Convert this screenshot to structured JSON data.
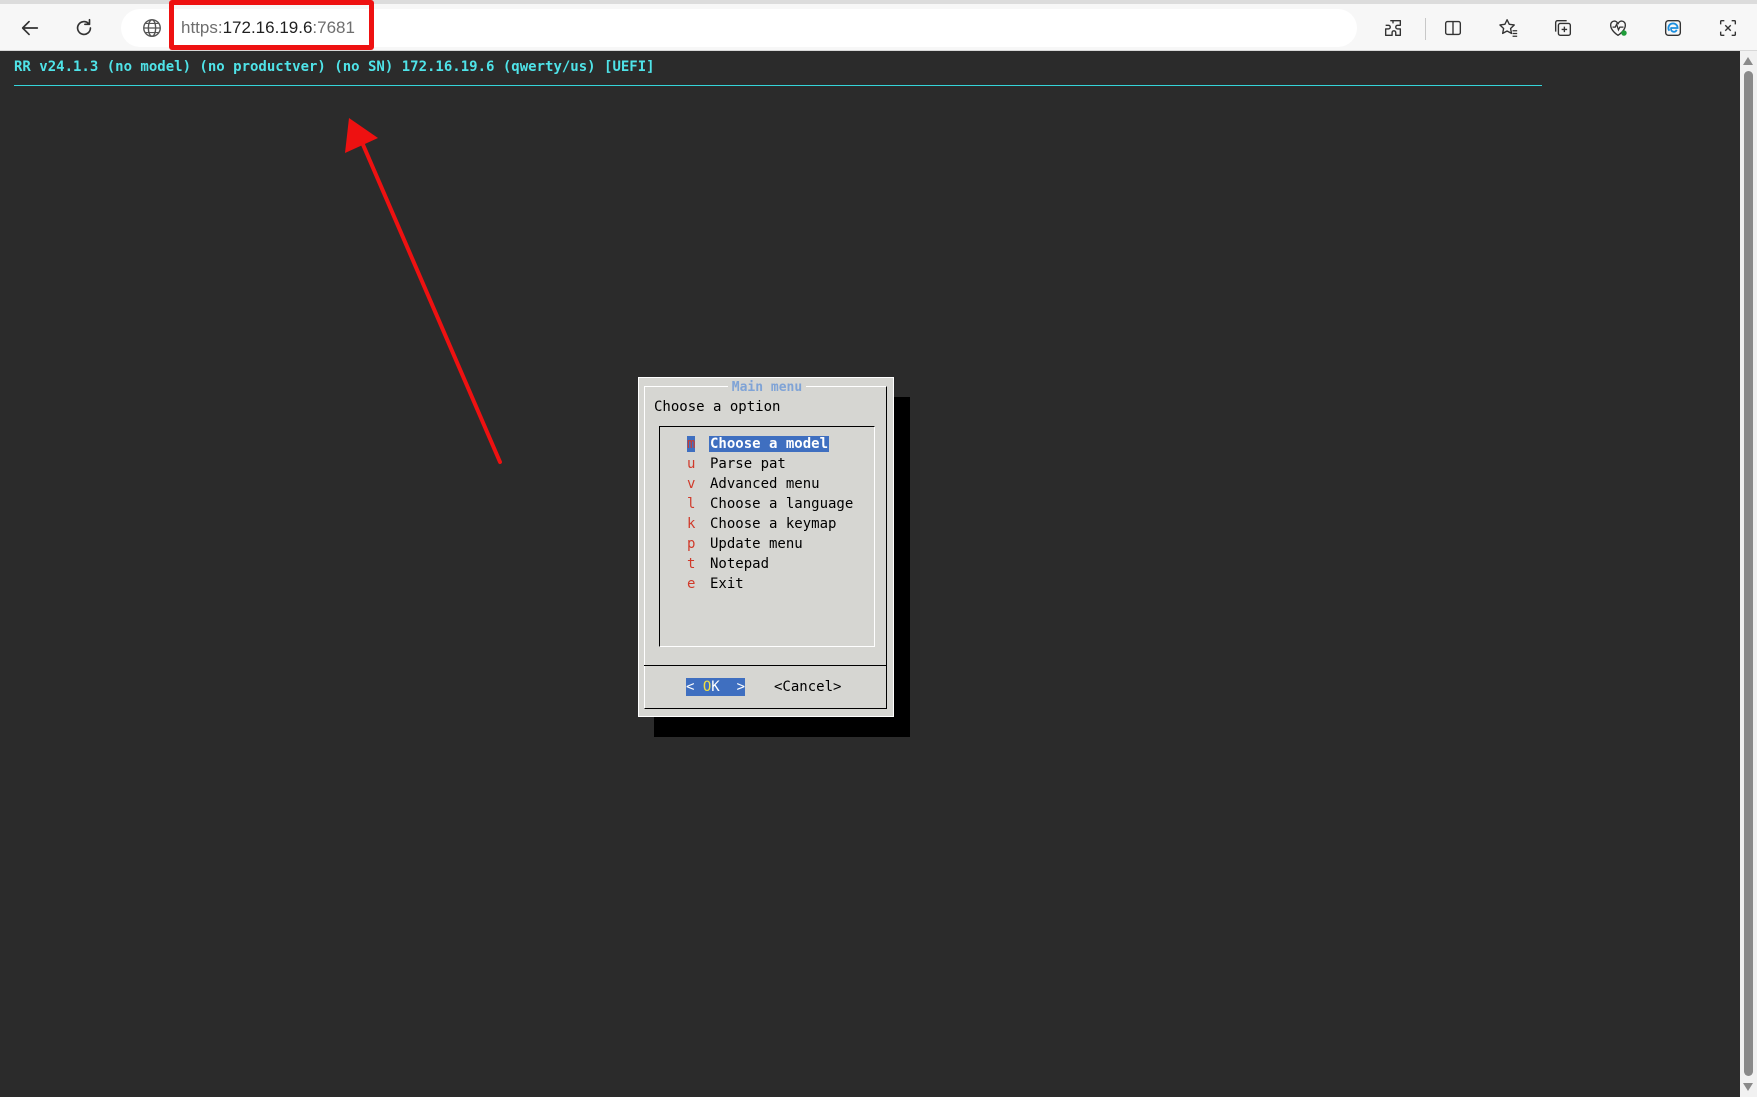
{
  "browser": {
    "url_scheme": "https:",
    "url_host": "172.16.19.6",
    "url_port": ":7681",
    "icons": [
      "back-arrow-icon",
      "reload-icon",
      "globe-icon",
      "extensions-icon",
      "split-screen-icon",
      "favorites-icon",
      "collections-icon",
      "browser-essentials-icon",
      "edge-copilot-icon",
      "screenshot-icon"
    ]
  },
  "terminal": {
    "header": "RR v24.1.3 (no model) (no productver) (no SN) 172.16.19.6 (qwerty/us) [UEFI]"
  },
  "dialog": {
    "title": "Main menu",
    "prompt": "Choose a option",
    "items": [
      {
        "key": "m",
        "label": "Choose a model"
      },
      {
        "key": "u",
        "label": "Parse pat"
      },
      {
        "key": "v",
        "label": "Advanced menu"
      },
      {
        "key": "l",
        "label": "Choose a language"
      },
      {
        "key": "k",
        "label": "Choose a keymap"
      },
      {
        "key": "p",
        "label": "Update menu"
      },
      {
        "key": "t",
        "label": "Notepad"
      },
      {
        "key": "e",
        "label": "Exit"
      }
    ],
    "selected_index": 0,
    "ok_left": "< ",
    "ok_hot": "O",
    "ok_rest": "K",
    "ok_right": "  >",
    "cancel_label": "<Cancel>"
  },
  "colors": {
    "terminal_bg": "#2b2b2b",
    "header_text": "#4fe3e8",
    "dialog_bg": "#d6d6d2",
    "selection": "#3f6fc0",
    "hotkey": "#d03a2a",
    "annotation": "#ee1111"
  }
}
